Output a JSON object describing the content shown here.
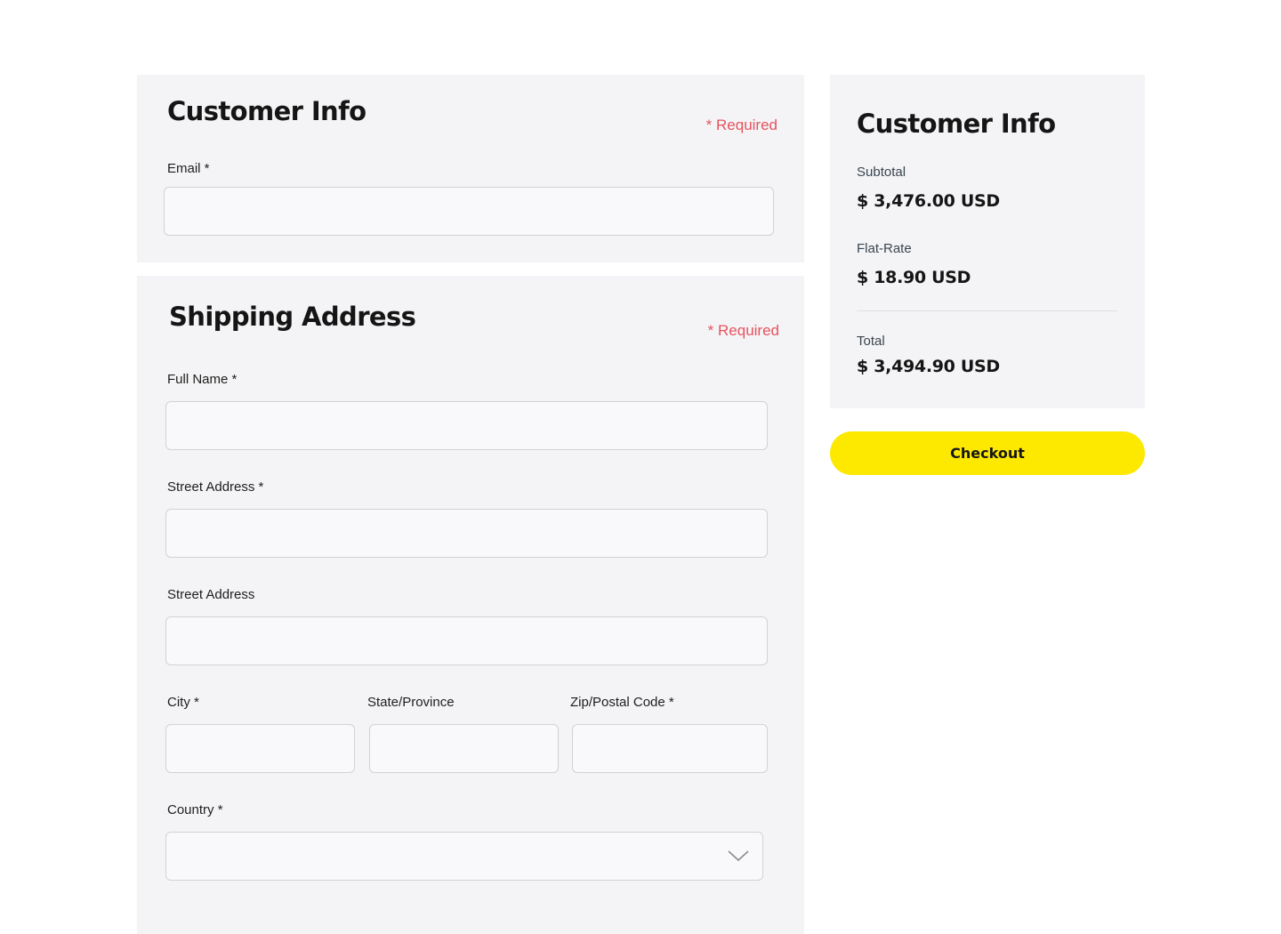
{
  "customer_info": {
    "title": "Customer Info",
    "required_note": "* Required",
    "email_label": "Email *"
  },
  "shipping": {
    "title": "Shipping Address",
    "required_note": "* Required",
    "full_name_label": "Full Name *",
    "street1_label": "Street Address *",
    "street2_label": "Street Address",
    "city_label": "City *",
    "state_label": "State/Province",
    "zip_label": "Zip/Postal Code *",
    "country_label": "Country *",
    "country_icon": "chevron-down-icon"
  },
  "summary": {
    "title": "Customer Info",
    "subtotal_label": "Subtotal",
    "subtotal_value": "$ 3,476.00 USD",
    "flat_rate_label": "Flat-Rate",
    "flat_rate_value": "$ 18.90 USD",
    "total_label": "Total",
    "total_value": "$ 3,494.90 USD"
  },
  "checkout_label": "Checkout",
  "colors": {
    "accent": "#fde800",
    "required": "#e5535e",
    "panel": "#f4f4f6"
  }
}
